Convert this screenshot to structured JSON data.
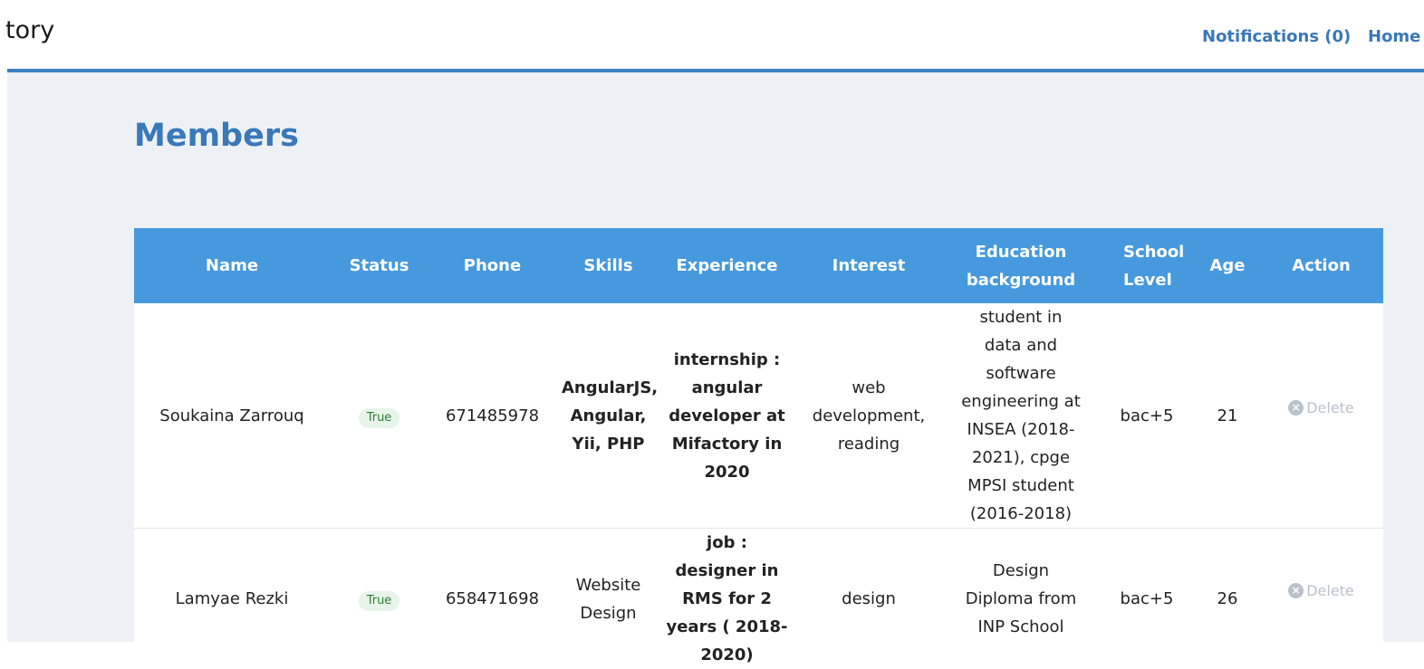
{
  "header": {
    "brand": "tory",
    "nav": {
      "notifications": "Notifications (0)",
      "home": "Home"
    }
  },
  "page": {
    "title": "Members"
  },
  "table": {
    "columns": [
      "Name",
      "Status",
      "Phone",
      "Skills",
      "Experience",
      "Interest",
      "Education background",
      "School Level",
      "Age",
      "Action"
    ],
    "rows": [
      {
        "name": "Soukaina Zarrouq",
        "status": "True",
        "phone": "671485978",
        "skills": "AngularJS, Angular, Yii, PHP",
        "experience": "internship : angular developer at Mifactory in 2020",
        "interest": "web development, reading",
        "education": "student in data and software engineering at INSEA (2018-2021), cpge MPSI student (2016-2018)",
        "level": "bac+5",
        "age": "21",
        "action": "Delete"
      },
      {
        "name": "Lamyae Rezki",
        "status": "True",
        "phone": "658471698",
        "skills": "Website Design",
        "experience": "job : designer in RMS for 2 years ( 2018-2020)",
        "interest": "design",
        "education": "Design Diploma from INP School",
        "level": "bac+5",
        "age": "26",
        "action": "Delete"
      }
    ]
  },
  "icons": {
    "delete": "x-circle-icon"
  },
  "colors": {
    "accent": "#3a78b8",
    "header_bg": "#4699dd",
    "content_bg": "#edf1f6",
    "badge_bg": "#e6f4ea",
    "badge_text": "#2e7d32",
    "muted": "#b9c2cc"
  }
}
